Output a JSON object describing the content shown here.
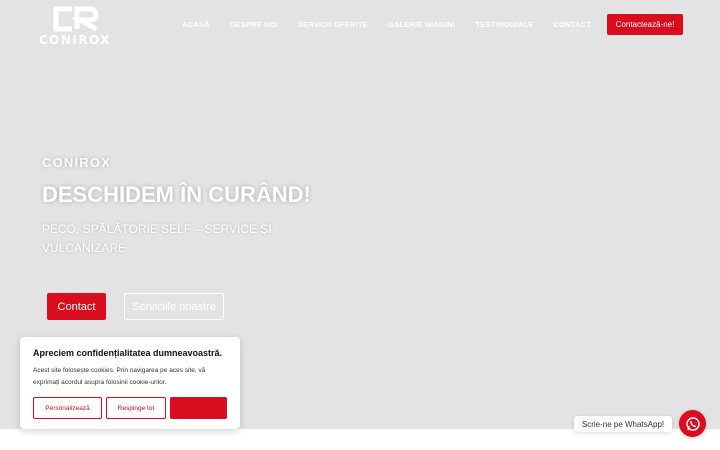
{
  "brand": {
    "name": "CONIROX",
    "accent": "#d90d1e"
  },
  "nav": {
    "items": [
      "ACASĂ",
      "DESPRE NOI",
      "SERVICII OFERITE",
      "GALERIE IMAGINI",
      "TESTIMONIALE",
      "CONTACT"
    ],
    "active_index": 0
  },
  "header_cta": "Contactează-ne!",
  "hero": {
    "kicker": "CONIROX",
    "title": "DESCHIDEM ÎN CURÂND!",
    "subtitle": "PECO, SPĂLĂTORIE SELF – SERVICE ȘI VULCANIZARE",
    "primary_button": "Contact",
    "secondary_button": "Serviciile noastre"
  },
  "cookie": {
    "title": "Apreciem confidențialitatea dumneavoastră.",
    "text": "Acest site folosește cookies. Prin navigarea pe aces site, vă exprimați acordul asupra folosinii cookie-urilor.",
    "personalize": "Personalizează",
    "reject": "Respinge tot",
    "accept": ""
  },
  "whatsapp": {
    "label": "Scrie-ne pe WhatsApp!",
    "icon": "whatsapp-icon"
  }
}
